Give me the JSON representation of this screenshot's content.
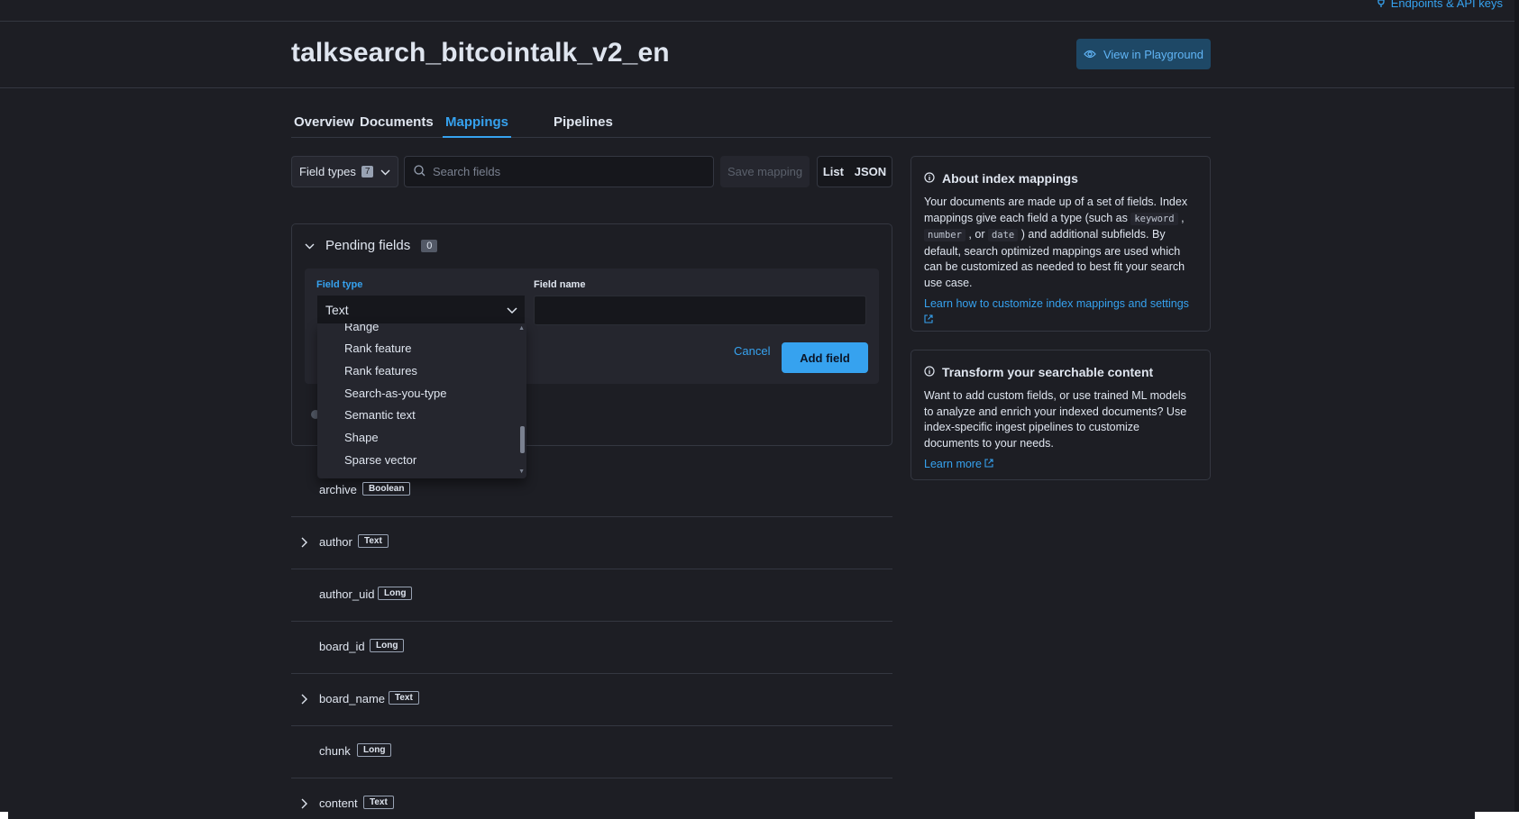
{
  "topbar": {
    "endpoints_label": "Endpoints & API keys"
  },
  "header": {
    "title": "talksearch_bitcointalk_v2_en",
    "playground_label": "View in Playground"
  },
  "tabs": [
    {
      "label": "Overview"
    },
    {
      "label": "Documents"
    },
    {
      "label": "Mappings"
    },
    {
      "label": "Pipelines"
    }
  ],
  "toolbar": {
    "field_types_label": "Field types",
    "field_types_count": "7",
    "search_placeholder": "Search fields",
    "save_label": "Save mapping",
    "list_label": "List",
    "json_label": "JSON"
  },
  "pending": {
    "title": "Pending fields",
    "count": "0",
    "field_type_label": "Field type",
    "field_name_label": "Field name",
    "selected_type": "Text",
    "cancel_label": "Cancel",
    "add_label": "Add field",
    "options": [
      "Range",
      "Rank feature",
      "Rank features",
      "Search-as-you-type",
      "Semantic text",
      "Shape",
      "Sparse vector"
    ]
  },
  "fields": [
    {
      "name": "archive",
      "type": "Boolean",
      "expandable": false
    },
    {
      "name": "author",
      "type": "Text",
      "expandable": true
    },
    {
      "name": "author_uid",
      "type": "Long",
      "expandable": false
    },
    {
      "name": "board_id",
      "type": "Long",
      "expandable": false
    },
    {
      "name": "board_name",
      "type": "Text",
      "expandable": true
    },
    {
      "name": "chunk",
      "type": "Long",
      "expandable": false
    },
    {
      "name": "content",
      "type": "Text",
      "expandable": true
    }
  ],
  "about": {
    "title": "About index mappings",
    "text_1": "Your documents are made up of a set of fields. Index mappings give each field a type (such as",
    "code_1": "keyword",
    "sep_1": ",",
    "code_2": "number",
    "sep_2": ", or",
    "code_3": "date",
    "text_2": ") and additional subfields. By default, search optimized mappings are used which can be customized as needed to best fit your search use case.",
    "link": "Learn how to customize index mappings and settings"
  },
  "transform": {
    "title": "Transform your searchable content",
    "text": "Want to add custom fields, or use trained ML models to analyze and enrich your indexed documents? Use index-specific ingest pipelines to customize documents to your needs.",
    "link": "Learn more"
  },
  "colors": {
    "accent": "#36a2ef",
    "background": "#1d1e24",
    "panel": "#25262e",
    "border": "#343741"
  }
}
